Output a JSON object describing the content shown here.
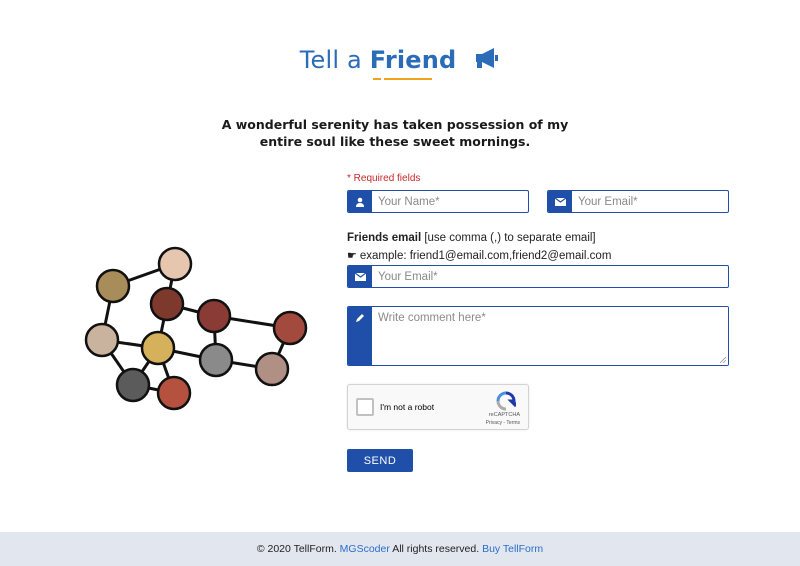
{
  "header": {
    "title_part1": "Tell a ",
    "title_part2": "Friend",
    "icon": "megaphone-icon"
  },
  "intro": {
    "text": "A wonderful serenity has taken possession of my entire soul like these sweet mornings."
  },
  "form": {
    "required_note": "* Required fields",
    "name_placeholder": "Your Name*",
    "email_placeholder": "Your Email*",
    "friends_label_bold": "Friends email",
    "friends_label_rest": " [use comma (,) to separate email]",
    "example_text": "example: friend1@email.com,friend2@email.com",
    "friends_placeholder": "Your Email*",
    "comment_placeholder": "Write comment here*",
    "captcha_label": "I'm not a robot",
    "captcha_brand": "reCAPTCHA",
    "captcha_terms": "Privacy - Terms",
    "send_label": "SEND"
  },
  "footer": {
    "copyright": "© 2020 TellForm. ",
    "author_link": "MGScoder",
    "rights": " All rights reserved. ",
    "buy_link": "Buy TellForm"
  },
  "colors": {
    "primary": "#1f4fa8",
    "title_blue": "#2b6cb8",
    "accent_orange": "#f0a21b",
    "required_red": "#c62828",
    "footer_bg": "#e2e6ee"
  }
}
